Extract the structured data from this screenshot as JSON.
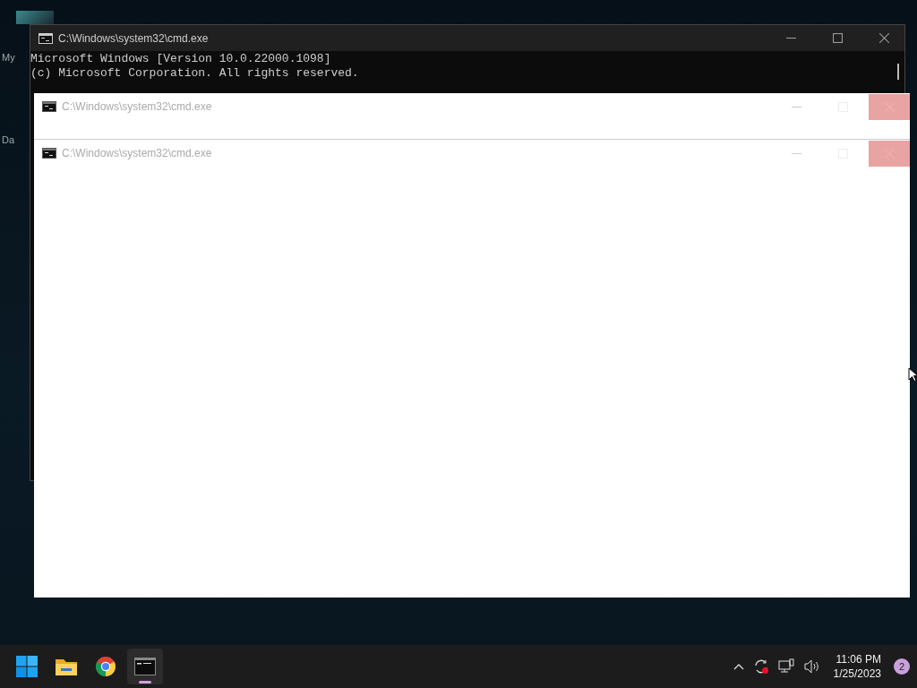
{
  "desktop": {
    "icon_labels": [
      "My",
      "Da"
    ]
  },
  "console_window": {
    "title": "C:\\Windows\\system32\\cmd.exe",
    "lines": [
      "Microsoft Windows [Version 10.0.22000.1098]",
      "(c) Microsoft Corporation. All rights reserved."
    ]
  },
  "blank_windows": [
    {
      "title": "C:\\Windows\\system32\\cmd.exe"
    },
    {
      "title": "C:\\Windows\\system32\\cmd.exe"
    }
  ],
  "taskbar": {
    "apps": [
      {
        "kind": "start",
        "selected": false
      },
      {
        "kind": "folder",
        "selected": false
      },
      {
        "kind": "browser",
        "selected": false
      },
      {
        "kind": "terminal",
        "selected": true
      }
    ],
    "time": "11:06 PM",
    "date": "1/25/2023",
    "notification_count": "2"
  }
}
